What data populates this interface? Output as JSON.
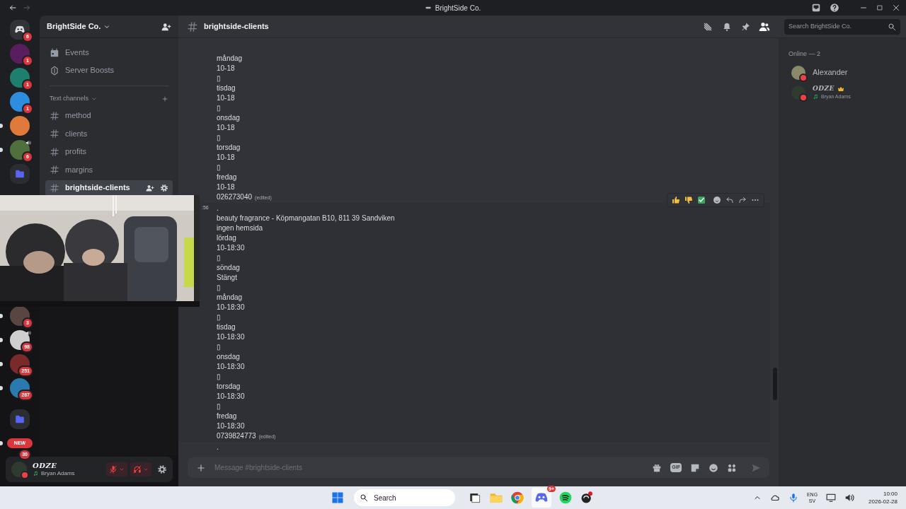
{
  "titlebar": {
    "title": "BrightSide Co."
  },
  "servers_top": [
    {
      "kind": "home",
      "color": "#313338",
      "badge": "6",
      "unread": false,
      "voice": false
    },
    {
      "kind": "avatar",
      "color": "#5a1d5e",
      "badge": "1",
      "unread": false,
      "voice": false
    },
    {
      "kind": "avatar",
      "color": "#1f7f6e",
      "badge": "1",
      "unread": false,
      "voice": false
    },
    {
      "kind": "avatar",
      "color": "#2d8ee0",
      "badge": "1",
      "unread": false,
      "voice": false
    },
    {
      "kind": "avatar",
      "color": "#e07a3a",
      "unread": true,
      "voice": false
    },
    {
      "kind": "avatar",
      "color": "#4f6f3c",
      "badge": "6",
      "unread": true,
      "voice": true
    },
    {
      "kind": "folder",
      "color": "#5865f2",
      "unread": false,
      "voice": false
    }
  ],
  "servers_bottom": [
    {
      "kind": "avatar",
      "color": "#5a4640",
      "badge": "3",
      "unread": true,
      "voice": false
    },
    {
      "kind": "avatar",
      "color": "#cfcfcf",
      "badge": "98",
      "unread": true,
      "voice": true
    },
    {
      "kind": "avatar",
      "color": "#7a2a2a",
      "badge": "251",
      "unread": true,
      "voice": false
    },
    {
      "kind": "avatar",
      "color": "#2a7ab0",
      "badge": "287",
      "unread": true,
      "voice": false
    },
    {
      "kind": "folder",
      "color": "#5865f2",
      "unread": false,
      "voice": false
    },
    {
      "kind": "new",
      "label": "NEW",
      "badge": "30",
      "unread": true,
      "voice": false
    }
  ],
  "server": {
    "name": "BrightSide Co."
  },
  "sidebar_links": [
    {
      "kind": "events",
      "label": "Events"
    },
    {
      "kind": "boosts",
      "label": "Server Boosts"
    }
  ],
  "category": {
    "label": "Text channels"
  },
  "channels": [
    {
      "name": "method",
      "selected": false
    },
    {
      "name": "clients",
      "selected": false
    },
    {
      "name": "profits",
      "selected": false
    },
    {
      "name": "margins",
      "selected": false
    },
    {
      "name": "brightside-clients",
      "selected": true
    }
  ],
  "channel_header": {
    "name": "brightside-clients",
    "search_placeholder": "Search BrightSide Co."
  },
  "messages": [
    {
      "hovered": false,
      "edited": "(edited)",
      "lines": [
        "måndag",
        "10-18",
        "▯",
        "tisdag",
        "10-18",
        "▯",
        "onsdag",
        "10-18",
        "▯",
        "torsdag",
        "10-18",
        "▯",
        "fredag",
        "10-18",
        "026273040"
      ]
    },
    {
      "hovered": true,
      "timestamp": ":56",
      "edited": "(edited)",
      "lines": [
        ".",
        "beauty fragrance - Köpmangatan B10, 811 39 Sandviken",
        "ingen hemsida",
        "lördag",
        "10-18:30",
        "▯",
        "söndag",
        "Stängt",
        "▯",
        "måndag",
        "10-18:30",
        "▯",
        "tisdag",
        "10-18:30",
        "▯",
        "onsdag",
        "10-18:30",
        "▯",
        "torsdag",
        "10-18:30",
        "▯",
        "fredag",
        "10-18:30",
        "0739824773"
      ]
    },
    {
      "hovered": false,
      "lines": [
        "."
      ]
    }
  ],
  "composer": {
    "placeholder": "Message #brightside-clients",
    "gif_label": "GIF"
  },
  "members": {
    "heading": "Online — 2",
    "list": [
      {
        "name": "Alexander",
        "do_not_disturb": true,
        "owner": false,
        "color": "#8a8a6a"
      },
      {
        "name": "ODZE",
        "do_not_disturb": true,
        "owner": true,
        "activity": "Bryan Adams",
        "color": "#2f3b2f"
      }
    ]
  },
  "user_panel": {
    "name": "ODZE",
    "activity": "Bryan Adams",
    "do_not_disturb": true,
    "mic_muted": true,
    "deafened": true
  },
  "taskbar": {
    "search": "Search",
    "discord_badge": "9+",
    "lang": "ENG",
    "layout": "SV",
    "time": "10:00",
    "date": "2026-02-28"
  }
}
